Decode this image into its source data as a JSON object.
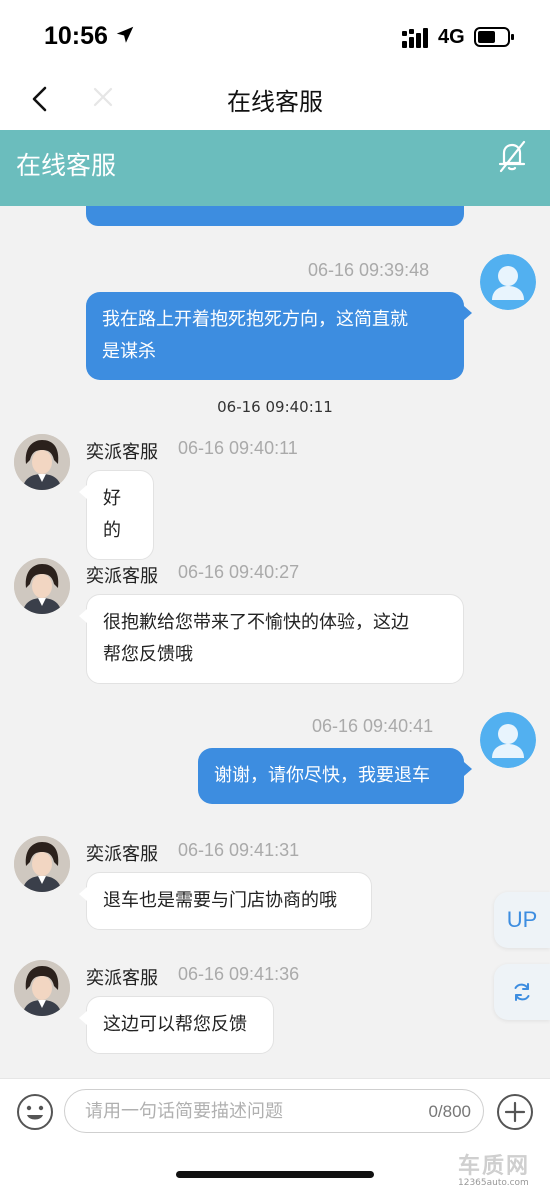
{
  "status_bar": {
    "time": "10:56",
    "network": "4G"
  },
  "nav": {
    "title": "在线客服"
  },
  "header": {
    "title": "在线客服"
  },
  "messages": [
    {
      "type": "outgoing",
      "timestamp": "06-16 09:39:48",
      "text_line1": "我在路上开着抱死抱死方向，这简直就",
      "text_line2": "是谋杀"
    },
    {
      "type": "system_time",
      "text": "06-16 09:40:11"
    },
    {
      "type": "incoming",
      "sender": "奕派客服",
      "timestamp": "06-16 09:40:11",
      "text": "好的"
    },
    {
      "type": "incoming",
      "sender": "奕派客服",
      "timestamp": "06-16 09:40:27",
      "text_line1": "很抱歉给您带来了不愉快的体验，这边",
      "text_line2": "帮您反馈哦"
    },
    {
      "type": "outgoing",
      "timestamp": "06-16 09:40:41",
      "text": "谢谢，请你尽快，我要退车"
    },
    {
      "type": "incoming",
      "sender": "奕派客服",
      "timestamp": "06-16 09:41:31",
      "text": "退车也是需要与门店协商的哦"
    },
    {
      "type": "incoming",
      "sender": "奕派客服",
      "timestamp": "06-16 09:41:36",
      "text": "这边可以帮您反馈"
    }
  ],
  "float_buttons": {
    "up_label": "UP"
  },
  "input": {
    "placeholder": "请用一句话简要描述问题",
    "char_count": "0/800"
  },
  "watermark": {
    "brand": "车质网",
    "site": "12365auto.com"
  },
  "colors": {
    "header": "#6bbdbd",
    "outgoing_bubble": "#3d8de0",
    "background": "#f2f2f2"
  },
  "icons": [
    "location-arrow-icon",
    "signal-icon",
    "battery-icon",
    "back-icon",
    "close-icon",
    "bell-off-icon",
    "user-avatar-icon",
    "agent-avatar",
    "refresh-icon",
    "emoji-icon",
    "plus-icon"
  ]
}
